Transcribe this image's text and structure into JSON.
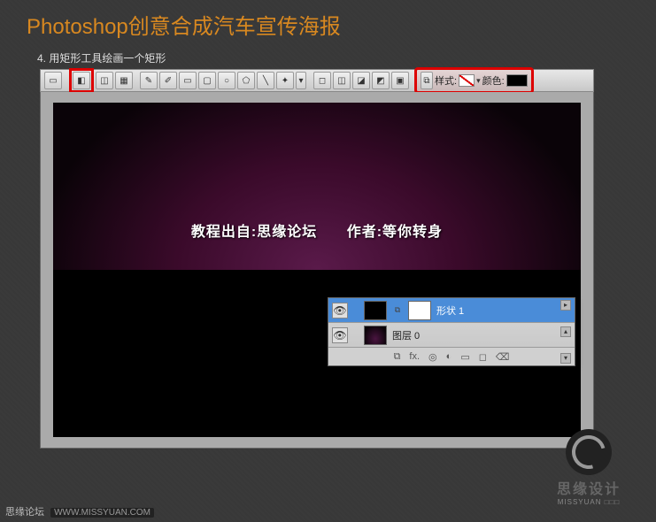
{
  "page": {
    "title": "Photoshop创意合成汽车宣传海报",
    "step": "4. 用矩形工具绘画一个矩形"
  },
  "toolbar": {
    "style_label": "样式:",
    "color_label": "颜色:"
  },
  "watermark": {
    "source": "教程出自:思缘论坛",
    "author": "作者:等你转身"
  },
  "layers": {
    "items": [
      {
        "name": "形状 1",
        "active": true
      },
      {
        "name": "图层 0",
        "active": false
      }
    ],
    "tools": {
      "link": "⧉",
      "fx": "fx.",
      "mask": "◎",
      "adjust": "◐",
      "folder": "▭",
      "new": "◻",
      "trash": "⌫"
    }
  },
  "logo": {
    "cn": "思缘设计",
    "en": "MISSYUAN □□□"
  },
  "footer": {
    "label": "思缘论坛",
    "url": "WWW.MISSYUAN.COM"
  }
}
